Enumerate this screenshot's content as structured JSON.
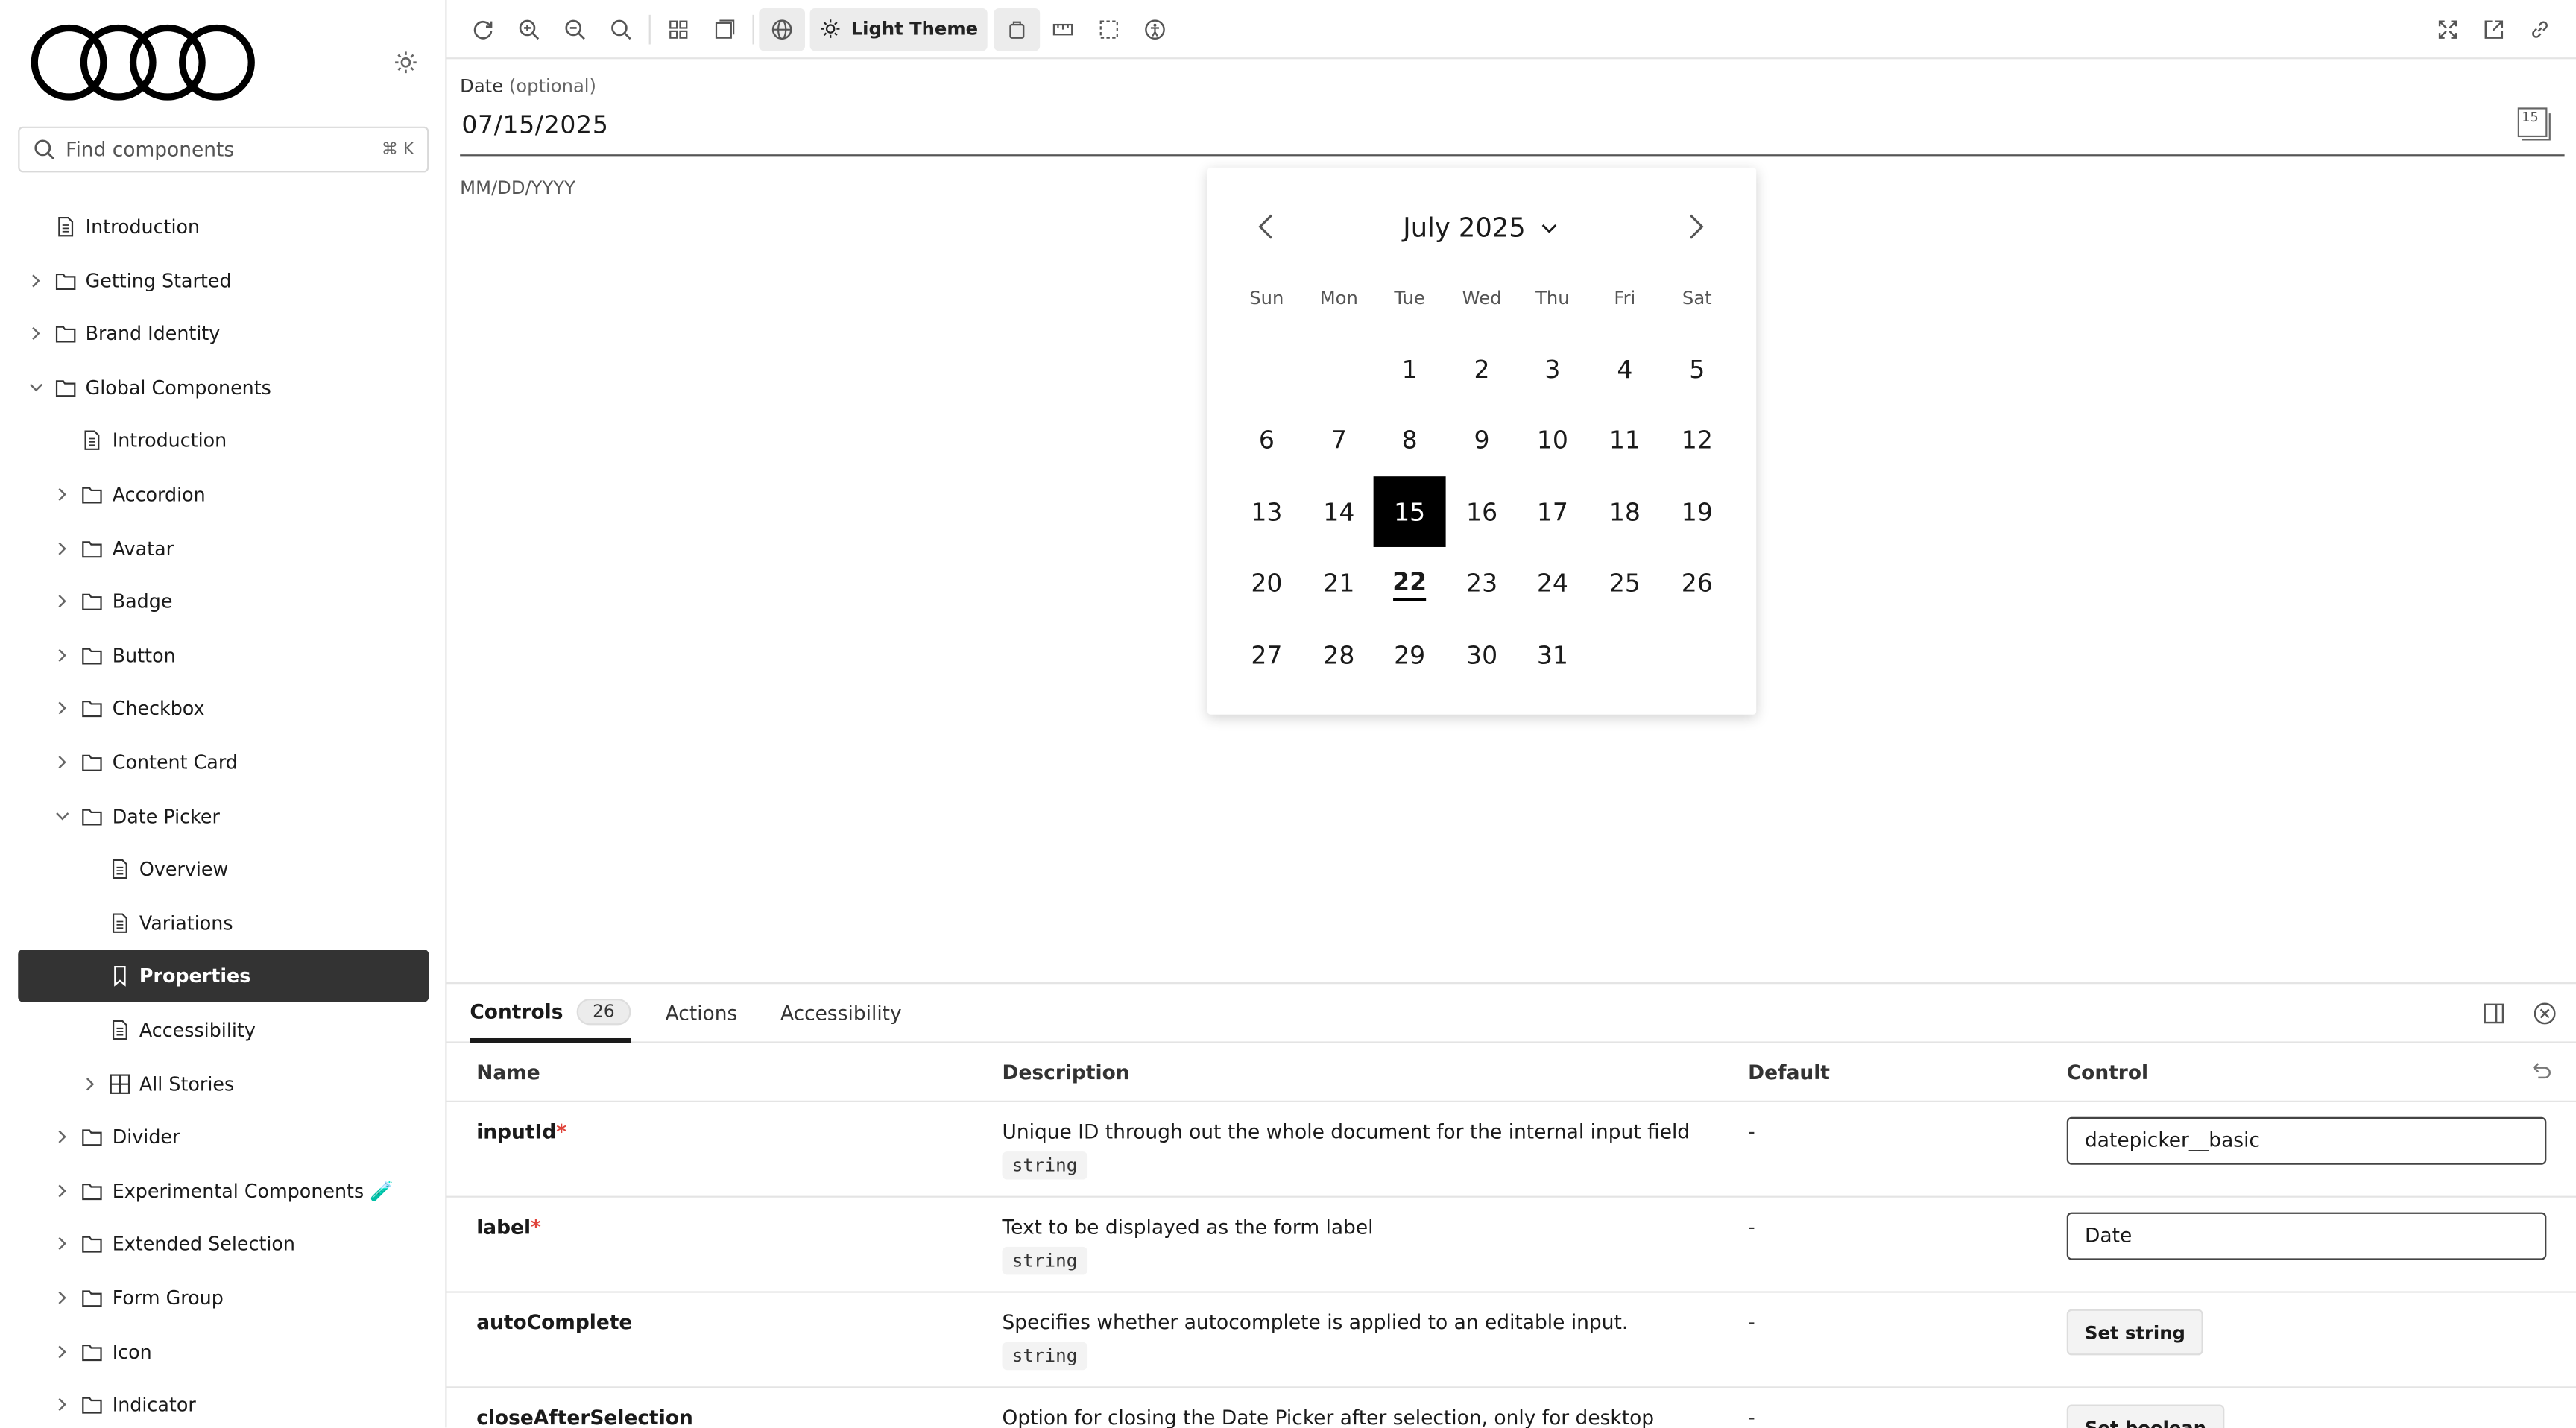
{
  "sidebar": {
    "search": {
      "placeholder": "Find components",
      "shortcut": "⌘ K"
    },
    "items": [
      {
        "label": "Introduction",
        "type": "doc",
        "level": 0,
        "expander": "none"
      },
      {
        "label": "Getting Started",
        "type": "folder",
        "level": 0,
        "expander": "collapsed"
      },
      {
        "label": "Brand Identity",
        "type": "folder",
        "level": 0,
        "expander": "collapsed"
      },
      {
        "label": "Global Components",
        "type": "folder",
        "level": 0,
        "expander": "expanded"
      },
      {
        "label": "Introduction",
        "type": "doc",
        "level": 1,
        "expander": "none"
      },
      {
        "label": "Accordion",
        "type": "folder",
        "level": 1,
        "expander": "collapsed"
      },
      {
        "label": "Avatar",
        "type": "folder",
        "level": 1,
        "expander": "collapsed"
      },
      {
        "label": "Badge",
        "type": "folder",
        "level": 1,
        "expander": "collapsed"
      },
      {
        "label": "Button",
        "type": "folder",
        "level": 1,
        "expander": "collapsed"
      },
      {
        "label": "Checkbox",
        "type": "folder",
        "level": 1,
        "expander": "collapsed"
      },
      {
        "label": "Content Card",
        "type": "folder",
        "level": 1,
        "expander": "collapsed"
      },
      {
        "label": "Date Picker",
        "type": "folder",
        "level": 1,
        "expander": "expanded"
      },
      {
        "label": "Overview",
        "type": "doc",
        "level": 2,
        "expander": "none"
      },
      {
        "label": "Variations",
        "type": "doc",
        "level": 2,
        "expander": "none"
      },
      {
        "label": "Properties",
        "type": "bookmark",
        "level": 2,
        "expander": "none",
        "active": true
      },
      {
        "label": "Accessibility",
        "type": "doc",
        "level": 2,
        "expander": "none"
      },
      {
        "label": "All Stories",
        "type": "grid",
        "level": 2,
        "expander": "collapsed"
      },
      {
        "label": "Divider",
        "type": "folder",
        "level": 1,
        "expander": "collapsed"
      },
      {
        "label": "Experimental Components 🧪",
        "type": "folder",
        "level": 1,
        "expander": "collapsed"
      },
      {
        "label": "Extended Selection",
        "type": "folder",
        "level": 1,
        "expander": "collapsed"
      },
      {
        "label": "Form Group",
        "type": "folder",
        "level": 1,
        "expander": "collapsed"
      },
      {
        "label": "Icon",
        "type": "folder",
        "level": 1,
        "expander": "collapsed"
      },
      {
        "label": "Indicator",
        "type": "folder",
        "level": 1,
        "expander": "collapsed"
      }
    ]
  },
  "toolbar": {
    "theme_label": "Light Theme"
  },
  "preview": {
    "label": "Date",
    "label_optional": "(optional)",
    "value": "07/15/2025",
    "calendar_icon_day": "15",
    "hint": "MM/DD/YYYY",
    "calendar": {
      "month_label": "July 2025",
      "weekdays": [
        "Sun",
        "Mon",
        "Tue",
        "Wed",
        "Thu",
        "Fri",
        "Sat"
      ],
      "days": [
        "1",
        "2",
        "3",
        "4",
        "5",
        "6",
        "7",
        "8",
        "9",
        "10",
        "11",
        "12",
        "13",
        "14",
        "15",
        "16",
        "17",
        "18",
        "19",
        "20",
        "21",
        "22",
        "23",
        "24",
        "25",
        "26",
        "27",
        "28",
        "29",
        "30",
        "31"
      ],
      "selected_day": "15",
      "today_day": "22"
    }
  },
  "panel": {
    "tabs": [
      {
        "label": "Controls",
        "count": "26",
        "active": true
      },
      {
        "label": "Actions"
      },
      {
        "label": "Accessibility"
      }
    ],
    "columns": {
      "name": "Name",
      "description": "Description",
      "default": "Default",
      "control": "Control"
    },
    "rows": [
      {
        "name": "inputId",
        "required": "*",
        "description": "Unique ID through out the whole document for the internal input field",
        "type": "string",
        "default": "-",
        "control_type": "input",
        "control_value": "datepicker__basic"
      },
      {
        "name": "label",
        "required": "*",
        "description": "Text to be displayed as the form label",
        "type": "string",
        "default": "-",
        "control_type": "input",
        "control_value": "Date"
      },
      {
        "name": "autoComplete",
        "required": "",
        "description": "Specifies whether autocomplete is applied to an editable input.",
        "type": "string",
        "default": "-",
        "control_type": "button",
        "control_value": "Set string"
      },
      {
        "name": "closeAfterSelection",
        "required": "",
        "description": "Option for closing the Date Picker after selection, only for desktop",
        "type": "",
        "default": "-",
        "control_type": "button",
        "control_value": "Set boolean"
      }
    ]
  }
}
